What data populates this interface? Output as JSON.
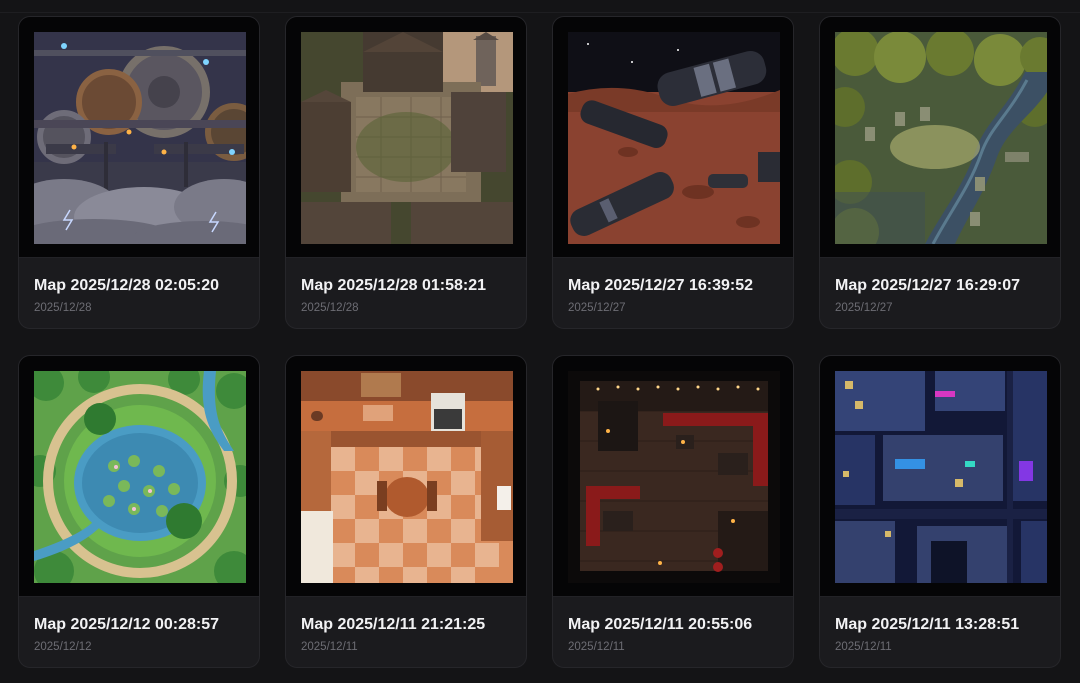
{
  "gallery": {
    "cards": [
      {
        "title": "Map 2025/12/28 02:05:20",
        "date": "2025/12/28",
        "thumbnail": "steampunk-gear-castle-in-storm-clouds"
      },
      {
        "title": "Map 2025/12/28 01:58:21",
        "date": "2025/12/28",
        "thumbnail": "ruined-village-courtyard"
      },
      {
        "title": "Map 2025/12/27 16:39:52",
        "date": "2025/12/27",
        "thumbnail": "crashed-spaceships-on-red-planet"
      },
      {
        "title": "Map 2025/12/27 16:29:07",
        "date": "2025/12/27",
        "thumbnail": "forest-ruins-with-river"
      },
      {
        "title": "Map 2025/12/12 00:28:57",
        "date": "2025/12/12",
        "thumbnail": "lily-pond-park"
      },
      {
        "title": "Map 2025/12/11 21:21:25",
        "date": "2025/12/11",
        "thumbnail": "kitchen-interior"
      },
      {
        "title": "Map 2025/12/11 20:55:06",
        "date": "2025/12/11",
        "thumbnail": "dark-bar-lounge-interior"
      },
      {
        "title": "Map 2025/12/11 13:28:51",
        "date": "2025/12/11",
        "thumbnail": "cyberpunk-neon-city-block"
      }
    ]
  }
}
